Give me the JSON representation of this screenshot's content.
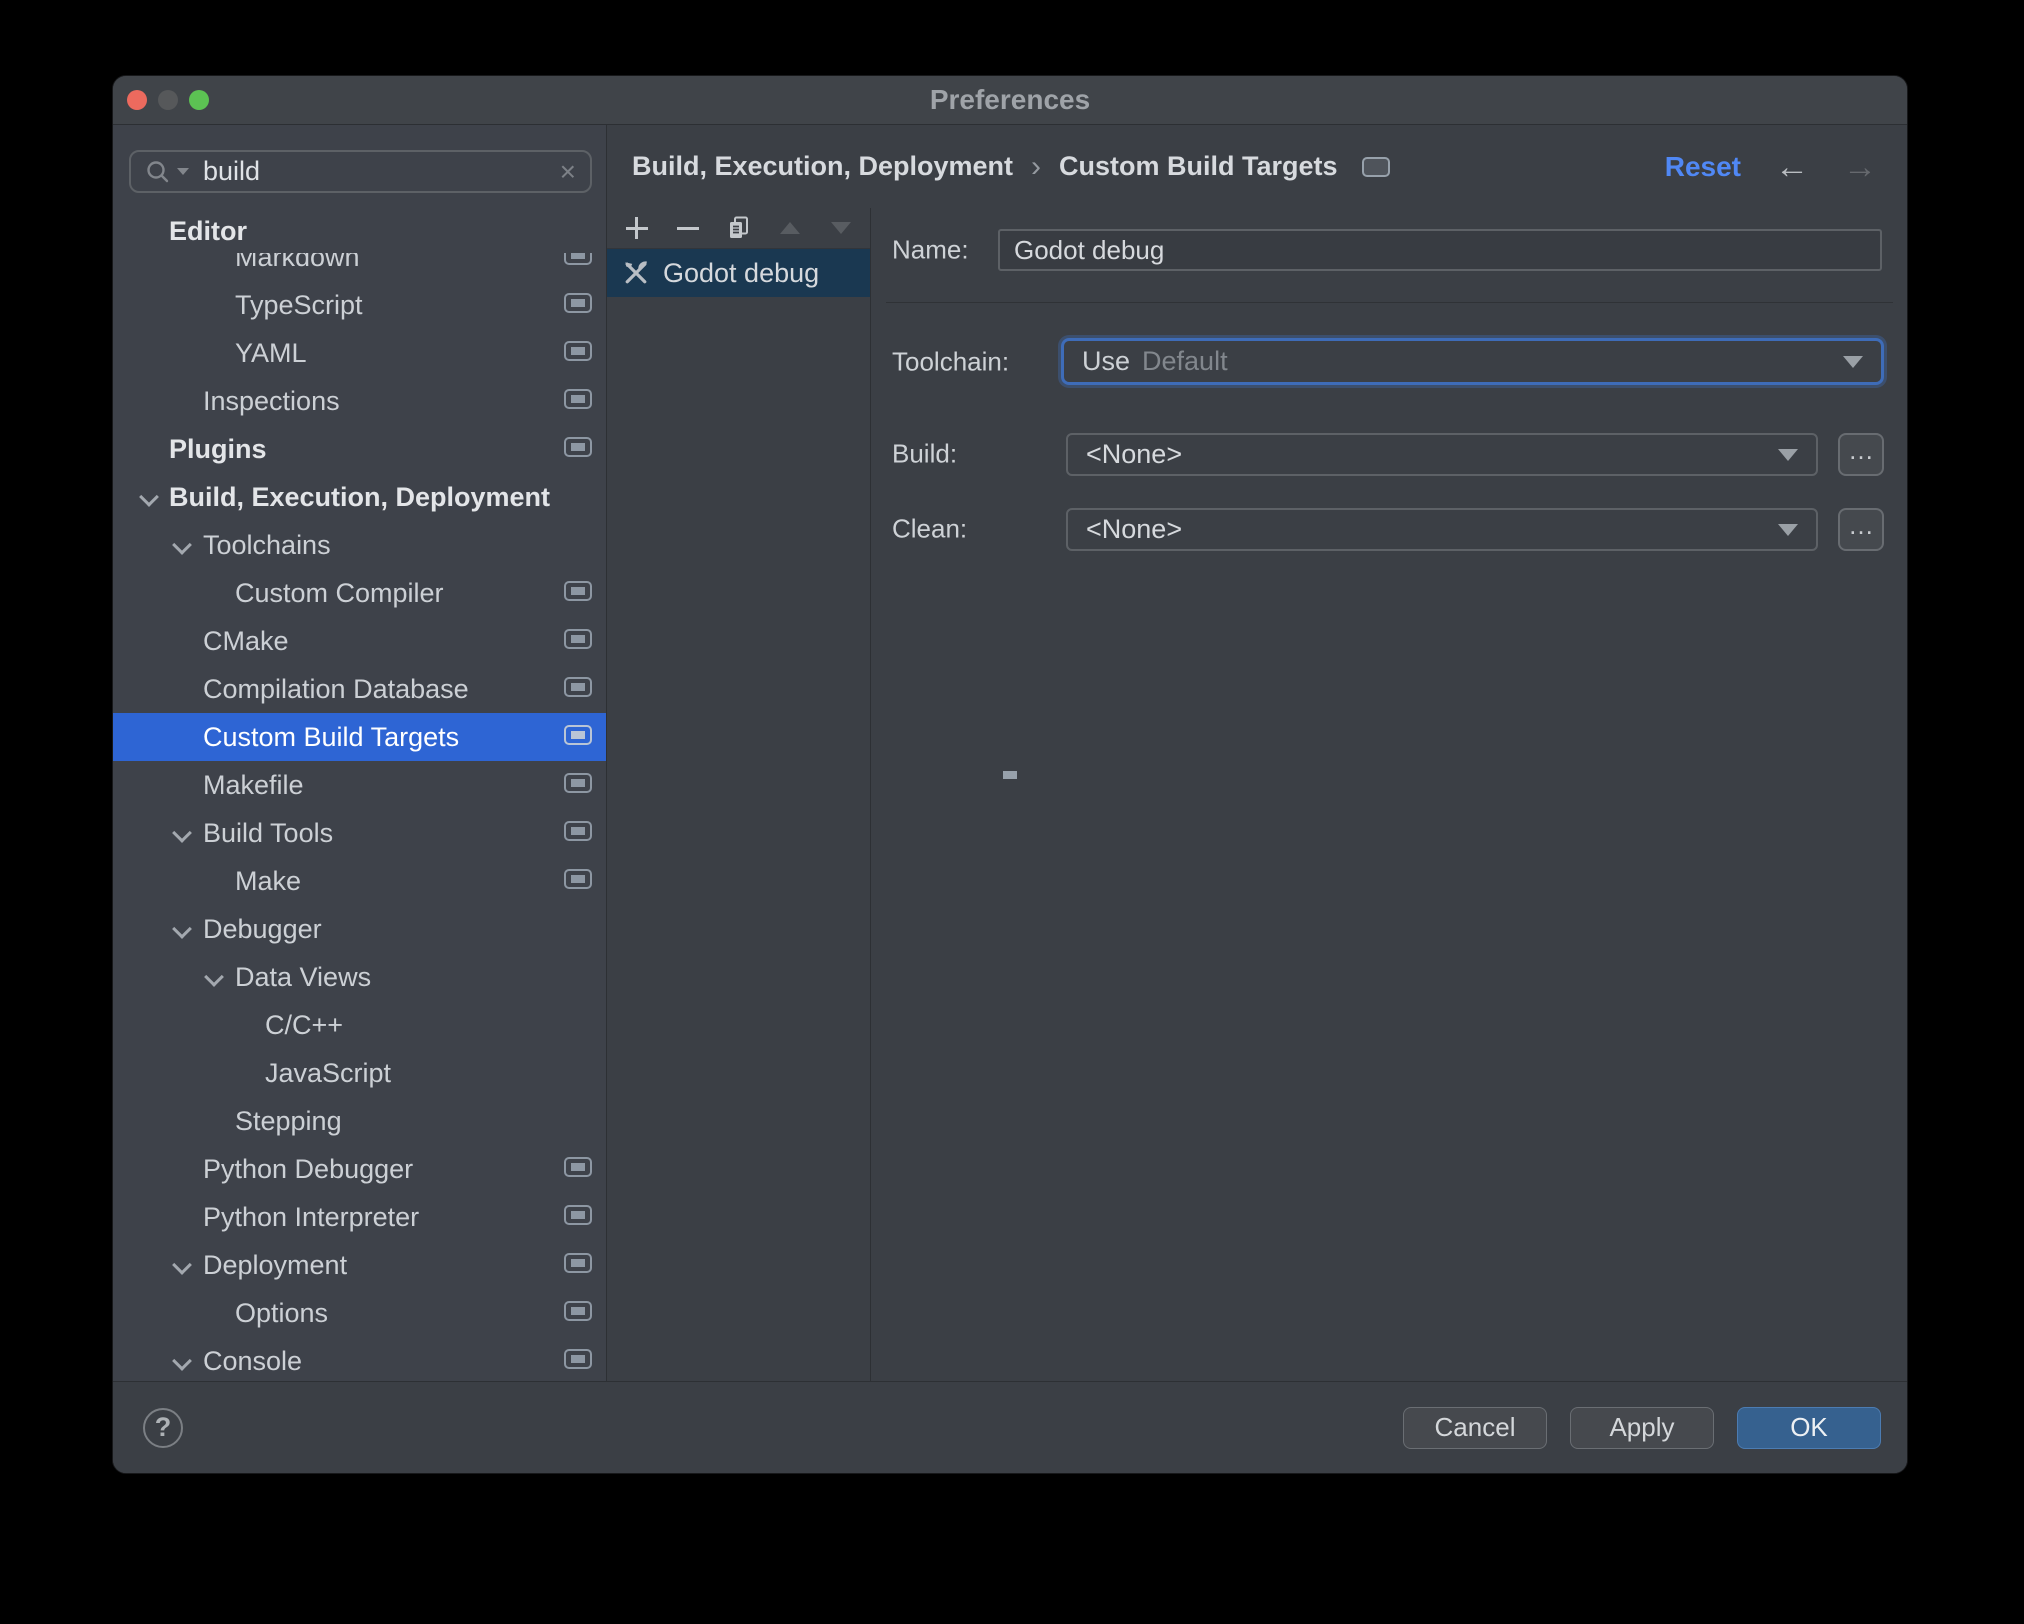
{
  "window": {
    "title": "Preferences"
  },
  "sidebar": {
    "search": {
      "value": "build"
    },
    "tree": [
      {
        "label": "Editor",
        "level": 0,
        "header": true,
        "sticky": true
      },
      {
        "label": "Markdown",
        "level": 2,
        "icon": true,
        "clipped": true
      },
      {
        "label": "TypeScript",
        "level": 2,
        "icon": true
      },
      {
        "label": "YAML",
        "level": 2,
        "icon": true
      },
      {
        "label": "Inspections",
        "level": 1,
        "icon": true
      },
      {
        "label": "Plugins",
        "level": 0,
        "header": true,
        "icon": true
      },
      {
        "label": "Build, Execution, Deployment",
        "level": 0,
        "header": true,
        "chevron": true
      },
      {
        "label": "Toolchains",
        "level": 1,
        "chevron": true
      },
      {
        "label": "Custom Compiler",
        "level": 2,
        "icon": true
      },
      {
        "label": "CMake",
        "level": 1,
        "icon": true
      },
      {
        "label": "Compilation Database",
        "level": 1,
        "icon": true
      },
      {
        "label": "Custom Build Targets",
        "level": 1,
        "icon": true,
        "selected": true
      },
      {
        "label": "Makefile",
        "level": 1,
        "icon": true
      },
      {
        "label": "Build Tools",
        "level": 1,
        "chevron": true,
        "icon": true
      },
      {
        "label": "Make",
        "level": 2,
        "icon": true
      },
      {
        "label": "Debugger",
        "level": 1,
        "chevron": true
      },
      {
        "label": "Data Views",
        "level": 2,
        "chevron": true
      },
      {
        "label": "C/C++",
        "level": 3
      },
      {
        "label": "JavaScript",
        "level": 3
      },
      {
        "label": "Stepping",
        "level": 2
      },
      {
        "label": "Python Debugger",
        "level": 1,
        "icon": true
      },
      {
        "label": "Python Interpreter",
        "level": 1,
        "icon": true
      },
      {
        "label": "Deployment",
        "level": 1,
        "chevron": true,
        "icon": true
      },
      {
        "label": "Options",
        "level": 2,
        "icon": true
      },
      {
        "label": "Console",
        "level": 1,
        "chevron": true,
        "icon": true
      }
    ]
  },
  "breadcrumb": {
    "parts": [
      "Build, Execution, Deployment",
      "Custom Build Targets"
    ],
    "separator": "›"
  },
  "header": {
    "reset_label": "Reset",
    "back_icon": "←",
    "forward_icon": "→"
  },
  "target_list": {
    "toolbar": [
      "add",
      "remove",
      "copy",
      "move-up",
      "move-down"
    ],
    "items": [
      {
        "label": "Godot debug",
        "selected": true
      }
    ]
  },
  "form": {
    "name": {
      "label": "Name:",
      "value": "Godot debug"
    },
    "toolchain": {
      "label": "Toolchain:",
      "prefix": "Use",
      "value": "Default"
    },
    "build": {
      "label": "Build:",
      "value": "<None>",
      "more": "…"
    },
    "clean": {
      "label": "Clean:",
      "value": "<None>",
      "more": "…"
    }
  },
  "footer": {
    "help": "?",
    "cancel": "Cancel",
    "apply": "Apply",
    "ok": "OK"
  },
  "colors": {
    "tree_selection": "#2e65d4",
    "list_selection": "#1a3851",
    "accent_link": "#5088f5",
    "ok_button": "#36618f",
    "focus_ring": "#3e6cb8",
    "traffic_close": "#ec6a5e",
    "traffic_zoom": "#5cc253"
  }
}
